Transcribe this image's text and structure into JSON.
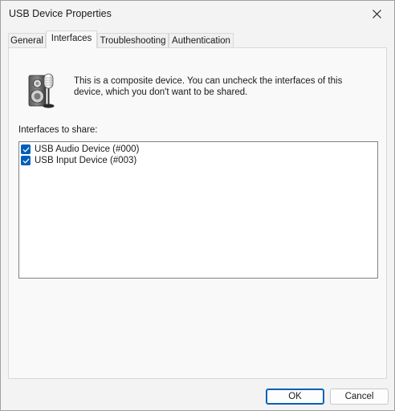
{
  "window": {
    "title": "USB Device Properties"
  },
  "tabs": [
    {
      "label": "General"
    },
    {
      "label": "Interfaces",
      "selected": true
    },
    {
      "label": "Troubleshooting"
    },
    {
      "label": "Authentication"
    }
  ],
  "interfaces_tab": {
    "icon": "speaker-microphone-icon",
    "intro": "This is a composite device. You can uncheck the interfaces of this device, which you don't want to be shared.",
    "list_label": "Interfaces to share:",
    "interfaces": [
      {
        "label": "USB Audio Device (#000)",
        "checked": true
      },
      {
        "label": "USB Input Device (#003)",
        "checked": true
      }
    ]
  },
  "buttons": {
    "ok": "OK",
    "cancel": "Cancel"
  },
  "colors": {
    "accent": "#005fb8",
    "window_bg": "#f3f3f3",
    "panel_bg": "#f9f9f9"
  }
}
